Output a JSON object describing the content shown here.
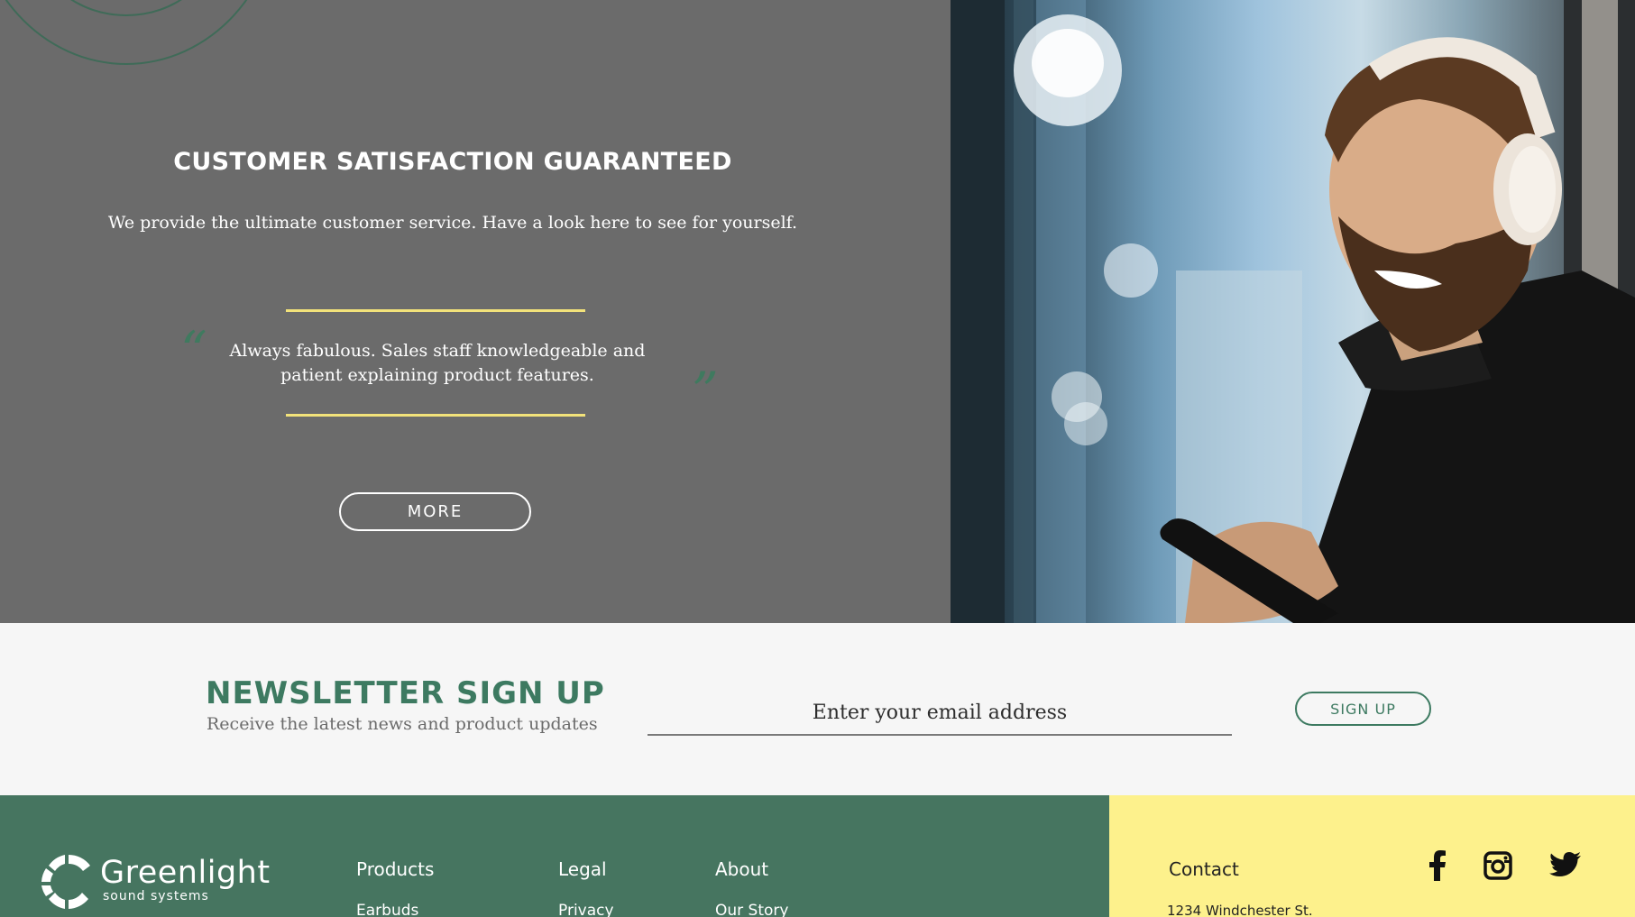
{
  "hero": {
    "title": "CUSTOMER SATISFACTION GUARANTEED",
    "subtitle": "We provide the ultimate customer service. Have a look here to see for yourself.",
    "quote_open": "“",
    "quote_close": "”",
    "quote_text": "Always fabulous. Sales staff knowledgeable and patient explaining product features.",
    "more_label": "MORE",
    "photo_icon": "man-with-headphones-photo",
    "accent_color": "#f2e27a"
  },
  "newsletter": {
    "title": "NEWSLETTER SIGN UP",
    "subtitle": "Receive the latest news and product updates",
    "email_placeholder": "Enter your email address",
    "email_value": "",
    "signup_label": "SIGN UP"
  },
  "footer": {
    "brand_name": "Greenlight",
    "brand_tagline": "sound systems",
    "columns": [
      {
        "heading": "Products",
        "first_link": "Earbuds"
      },
      {
        "heading": "Legal",
        "first_link": "Privacy"
      },
      {
        "heading": "About",
        "first_link": "Our Story"
      }
    ],
    "contact": {
      "heading": "Contact",
      "address_line": "1234 Windchester St."
    },
    "social_icons": [
      "facebook-icon",
      "instagram-icon",
      "twitter-icon"
    ],
    "colors": {
      "brand_green": "#467560",
      "contact_yellow": "#fdf18c"
    }
  }
}
